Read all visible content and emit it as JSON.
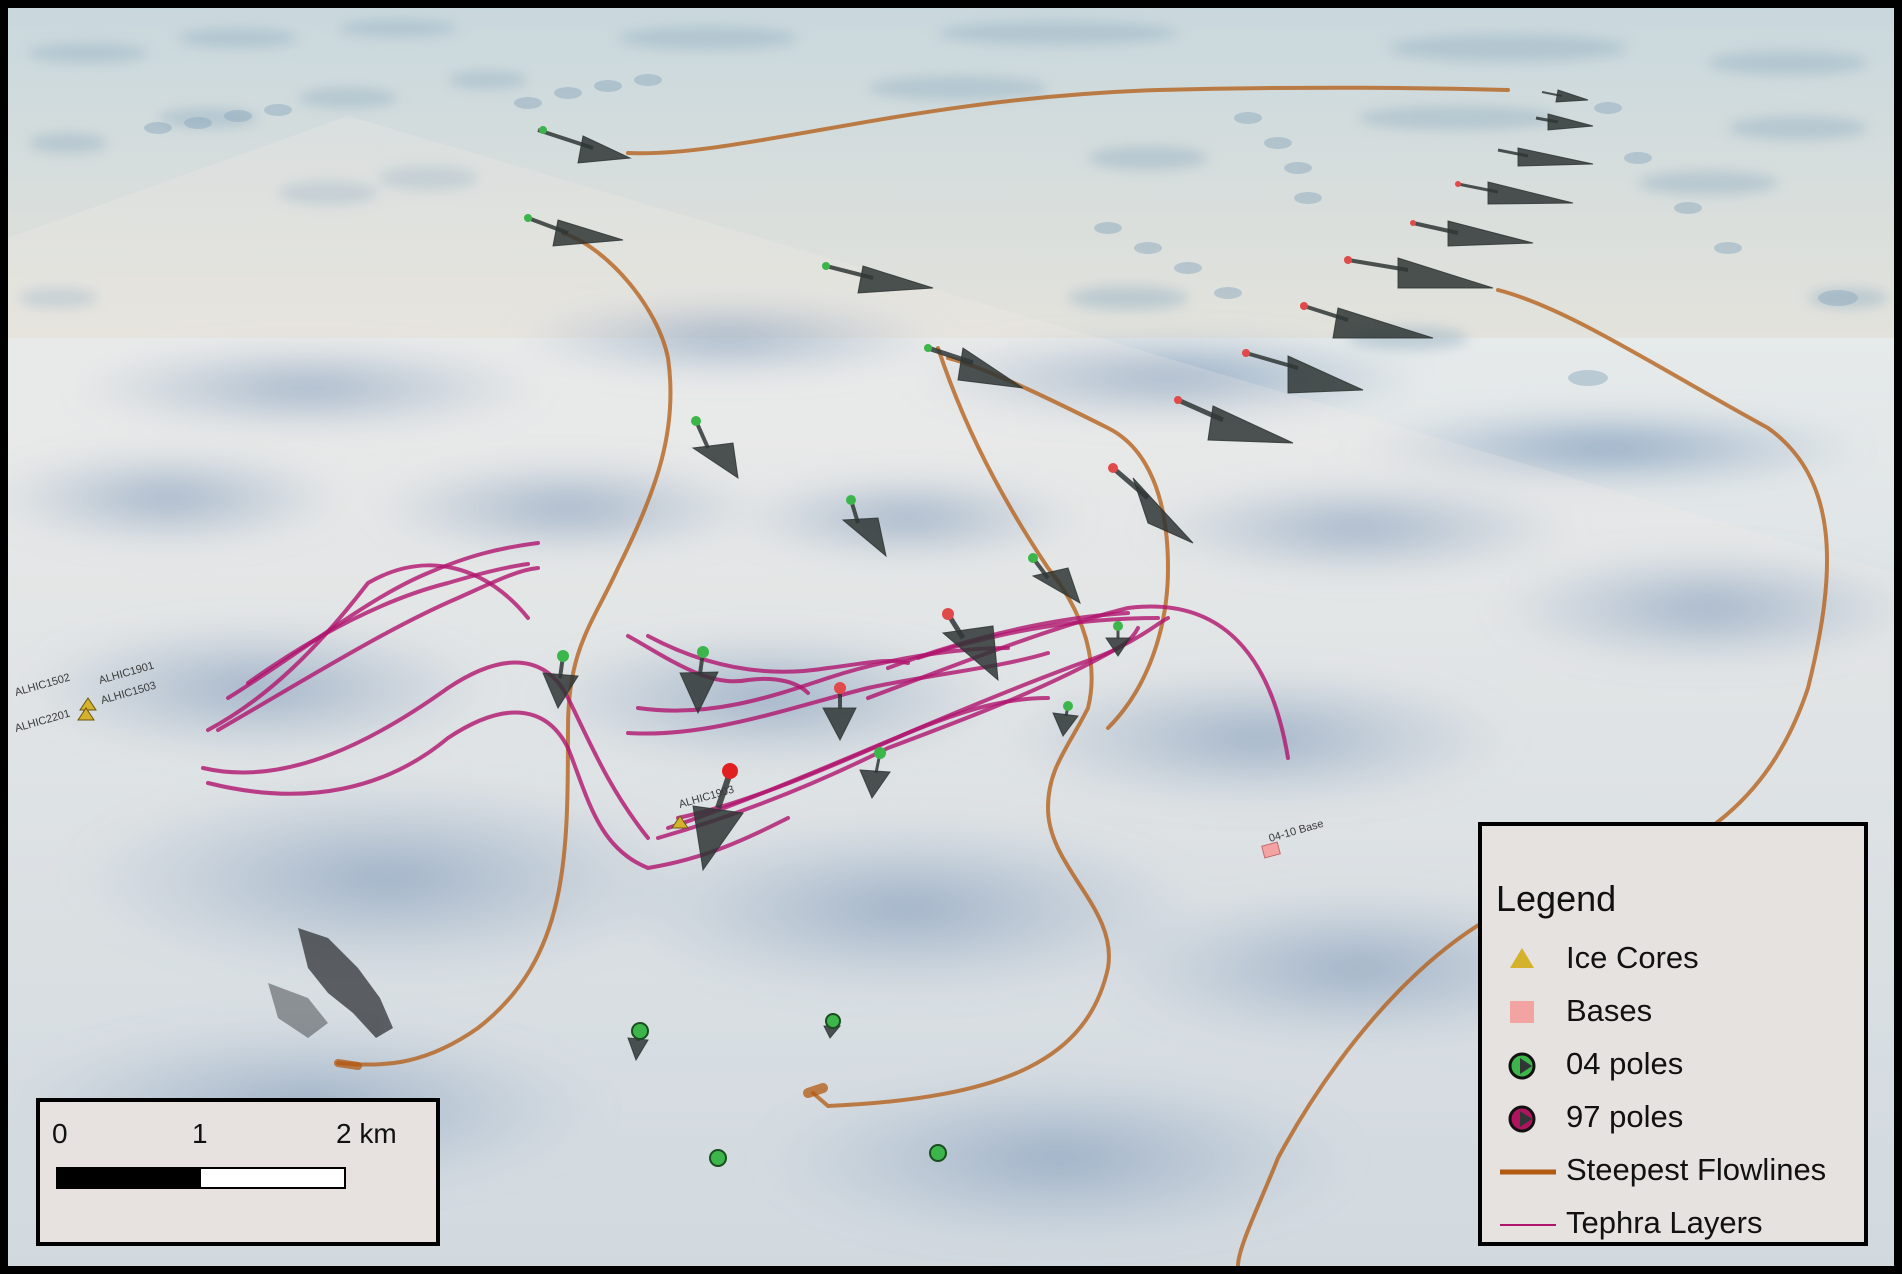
{
  "legend": {
    "title": "Legend",
    "items": [
      {
        "label": "Ice Cores",
        "icon": "triangle-icon",
        "color": "#d4b22c"
      },
      {
        "label": "Bases",
        "icon": "square-icon",
        "color": "#f4a3a3"
      },
      {
        "label": "04 poles",
        "icon": "pole-marker-icon",
        "color": "#3cb54a"
      },
      {
        "label": "97 poles",
        "icon": "pole-marker-icon",
        "color": "#b0145e"
      },
      {
        "label": "Steepest Flowlines",
        "icon": "line-icon",
        "color": "#b35a10"
      },
      {
        "label": "Tephra Layers",
        "icon": "line-icon",
        "color": "#b0146e"
      }
    ]
  },
  "scale_bar": {
    "ticks": [
      "0",
      "1",
      "2 km"
    ]
  },
  "map_labels": {
    "ice_cores": [
      "ALHIC1502",
      "ALHIC1901",
      "ALHIC2201",
      "ALHIC1503",
      "ALHIC1903"
    ],
    "base": "04-10 Base"
  },
  "colors": {
    "flowline": "#b35a10",
    "tephra": "#b0146e",
    "arrow": "#2f3635",
    "pole_04": "#3cb54a",
    "pole_97": "#e04a4a",
    "ice_core": "#d4b22c",
    "base": "#f4a3a3"
  }
}
